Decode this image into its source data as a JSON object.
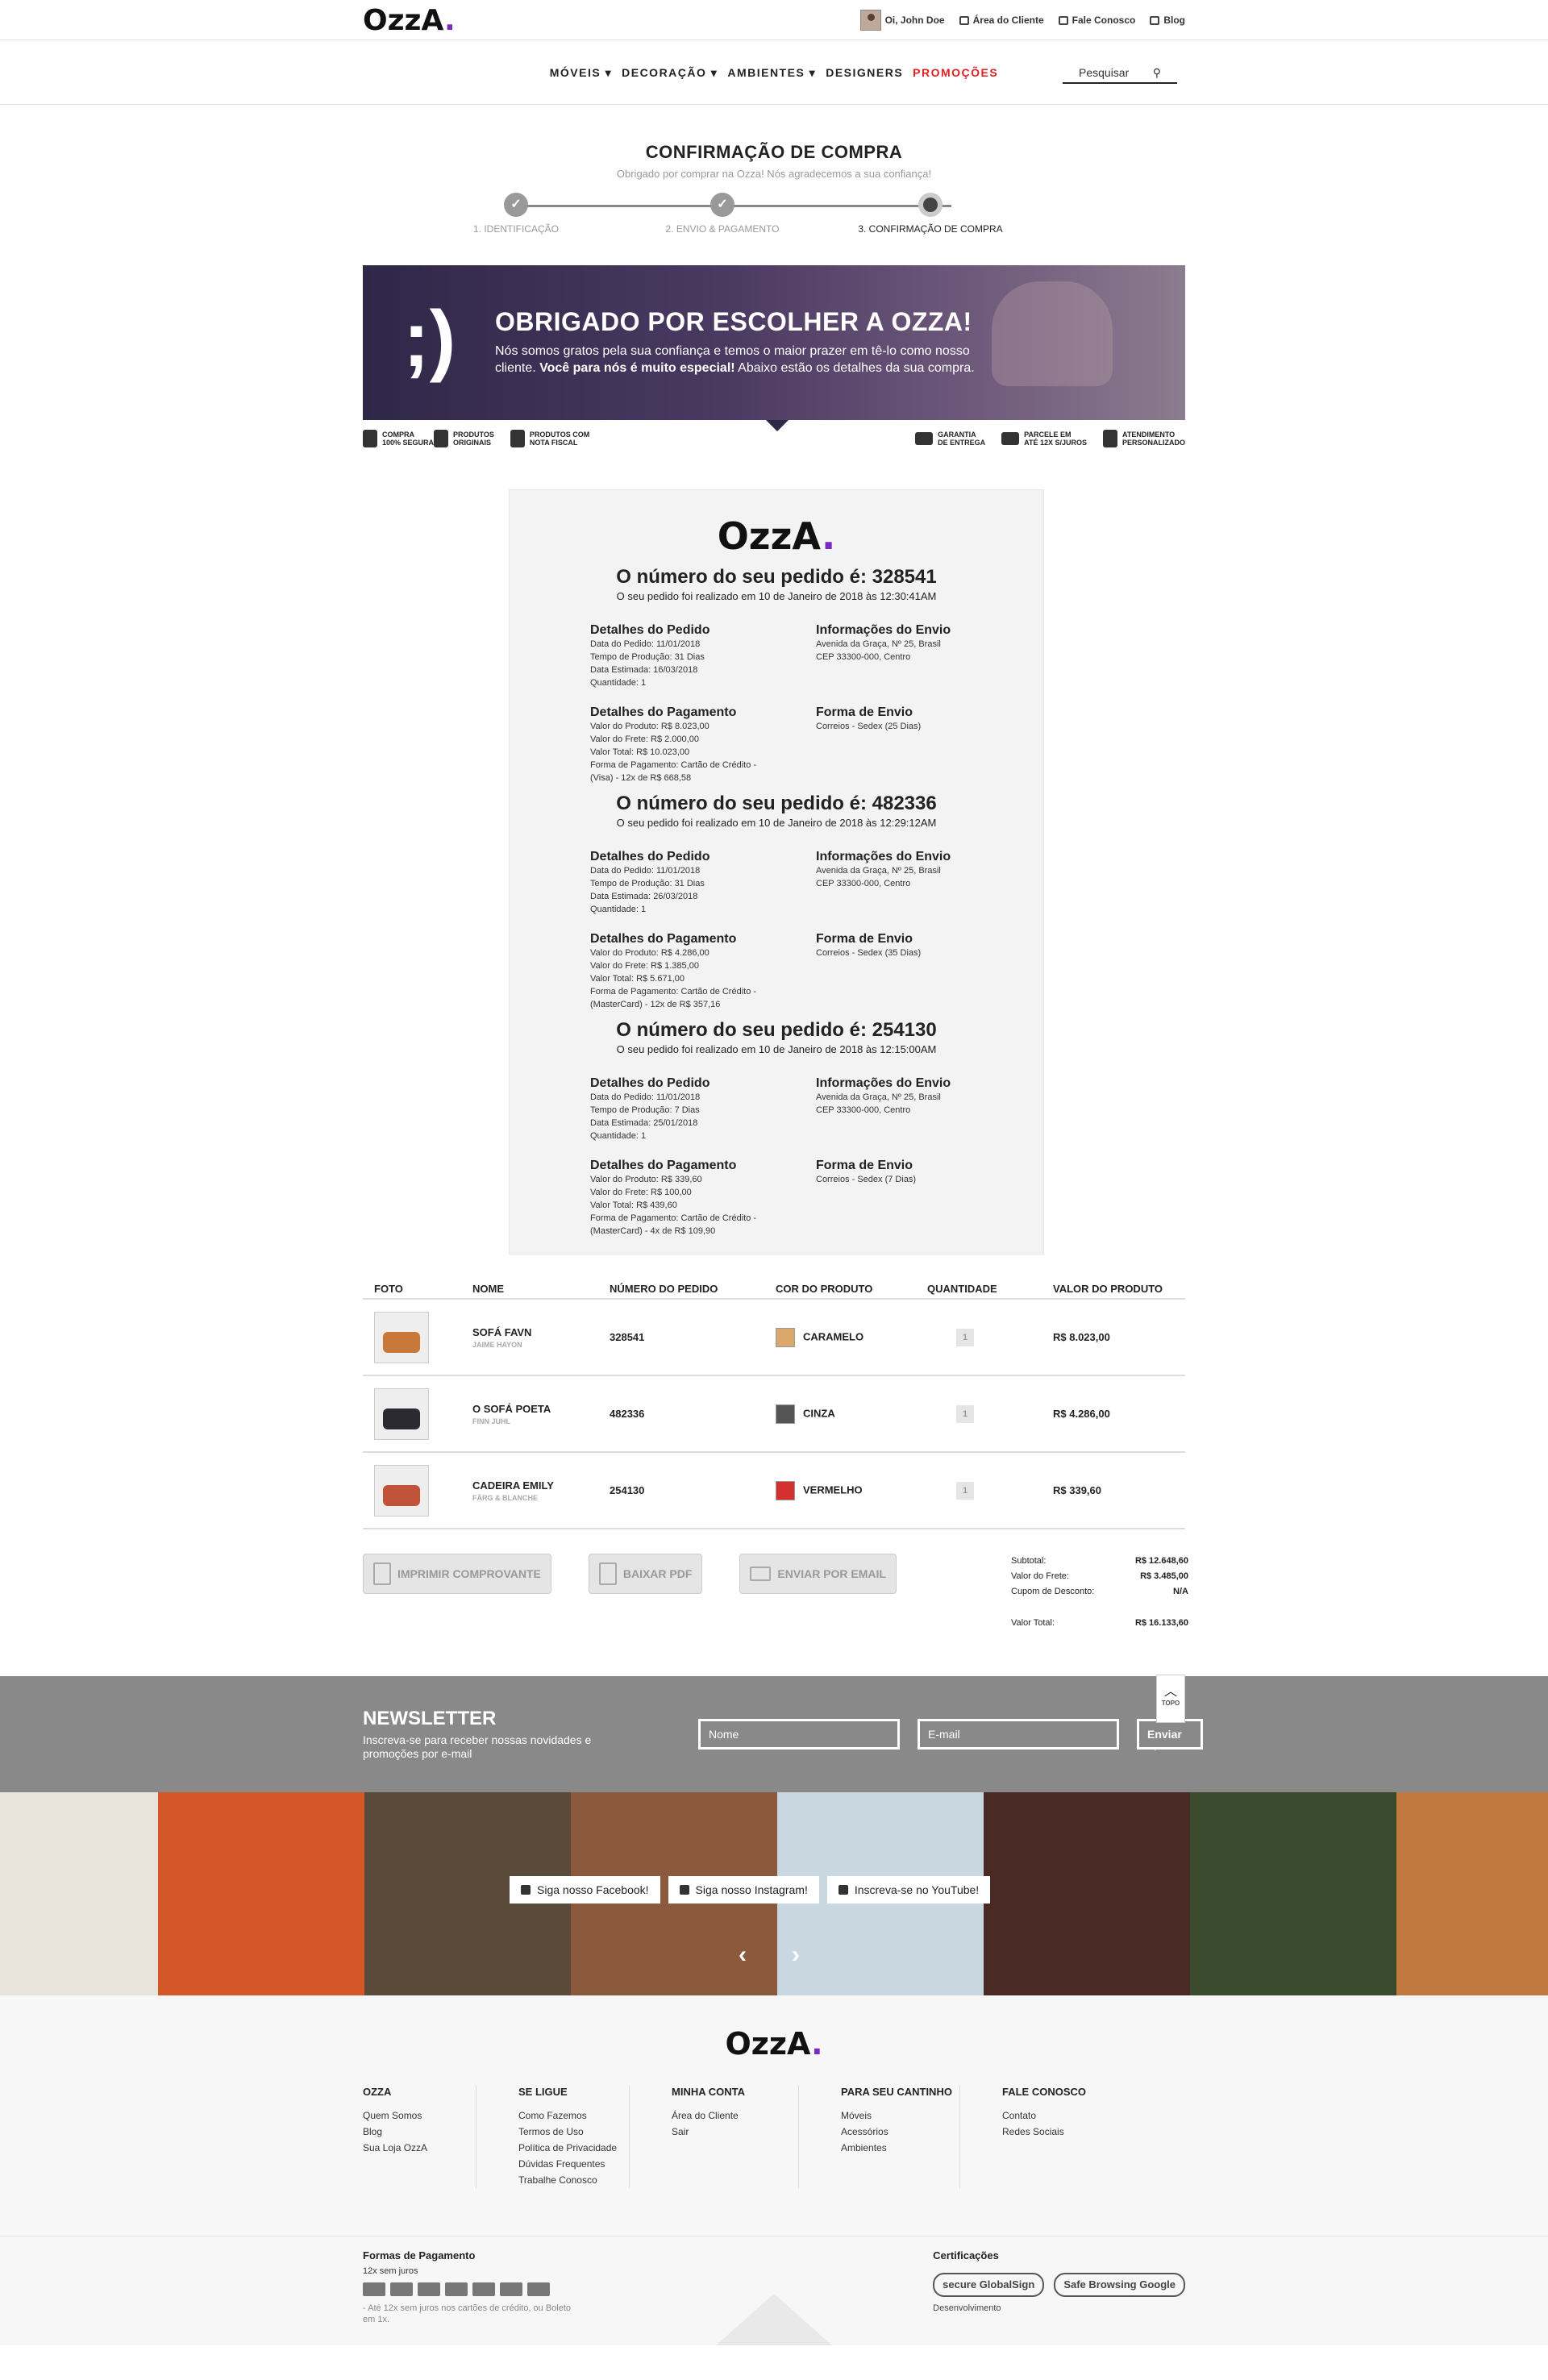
{
  "brand": {
    "logo_text": "OzzA",
    "logo_dot": "."
  },
  "topbar": {
    "greeting": "Oi, John Doe",
    "client_area": "Área do Cliente",
    "contact": "Fale Conosco",
    "blog": "Blog"
  },
  "nav": {
    "items": [
      {
        "label": "MÓVEIS",
        "caret": "▾"
      },
      {
        "label": "DECORAÇÃO",
        "caret": "▾"
      },
      {
        "label": "AMBIENTES",
        "caret": "▾"
      },
      {
        "label": "DESIGNERS",
        "caret": ""
      }
    ],
    "promo": "PROMOÇÕES",
    "search_placeholder": "Pesquisar"
  },
  "checkout": {
    "title": "CONFIRMAÇÃO DE COMPRA",
    "subtitle": "Obrigado por comprar na Ozza! Nós agradecemos a sua confiança!",
    "steps": [
      "1. IDENTIFICAÇÃO",
      "2. ENVIO & PAGAMENTO",
      "3. CONFIRMAÇÃO DE COMPRA"
    ]
  },
  "banner": {
    "wink": ";)",
    "title": "OBRIGADO POR ESCOLHER A OZZA!",
    "line1": "Nós somos gratos pela sua confiança e temos o maior prazer em tê-lo como nosso",
    "line2a": "cliente. ",
    "line2b": "Você para nós é muito especial!",
    "line2c": "  Abaixo estão os detalhes da sua compra."
  },
  "trust": [
    [
      "COMPRA",
      "100% SEGURA"
    ],
    [
      "PRODUTOS",
      "ORIGINAIS"
    ],
    [
      "PRODUTOS COM",
      "NOTA FISCAL"
    ],
    [
      "GARANTIA",
      "DE ENTREGA"
    ],
    [
      "PARCELE EM",
      "ATÉ 12X S/JUROS"
    ],
    [
      "ATENDIMENTO",
      "PERSONALIZADO"
    ]
  ],
  "orders": [
    {
      "heading": "O número do seu pedido é: 328541",
      "placed": "O seu pedido foi realizado em 10 de Janeiro de 2018 às 12:30:41AM",
      "details_title": "Detalhes do Pedido",
      "details": [
        "Data do Pedido: 11/01/2018",
        "Tempo de Produção: 31 Dias",
        "Data Estimada: 16/03/2018",
        "Quantidade: 1"
      ],
      "ship_title": "Informações do Envio",
      "ship": [
        "Avenida da Graça, Nº 25, Brasil",
        "CEP 33300-000, Centro"
      ],
      "pay_title": "Detalhes do Pagamento",
      "pay": [
        "Valor do Produto: R$ 8.023,00",
        "Valor do Frete: R$ 2.000,00",
        "Valor Total: R$ 10.023,00",
        "Forma de Pagamento: Cartão de Crédito -",
        "(Visa) - 12x de R$ 668,58"
      ],
      "method_title": "Forma de Envio",
      "method": "Correios - Sedex (25 Dias)"
    },
    {
      "heading": "O número do seu pedido é: 482336",
      "placed": "O seu pedido foi realizado em 10 de Janeiro de 2018 às 12:29:12AM",
      "details_title": "Detalhes do Pedido",
      "details": [
        "Data do Pedido: 11/01/2018",
        "Tempo de Produção: 31 Dias",
        "Data Estimada: 26/03/2018",
        "Quantidade: 1"
      ],
      "ship_title": "Informações do Envio",
      "ship": [
        "Avenida da Graça, Nº 25, Brasil",
        "CEP 33300-000, Centro"
      ],
      "pay_title": "Detalhes do Pagamento",
      "pay": [
        "Valor do Produto: R$ 4.286,00",
        "Valor do Frete: R$ 1.385,00",
        "Valor Total: R$ 5.671,00",
        "Forma de Pagamento: Cartão de Crédito -",
        "(MasterCard) - 12x de R$ 357,16"
      ],
      "method_title": "Forma de Envio",
      "method": "Correios - Sedex (35 Dias)"
    },
    {
      "heading": "O número do seu pedido é: 254130",
      "placed": "O seu pedido foi realizado em 10 de Janeiro de 2018 às 12:15:00AM",
      "details_title": "Detalhes do Pedido",
      "details": [
        "Data do Pedido: 11/01/2018",
        "Tempo de Produção: 7 Dias",
        "Data Estimada: 25/01/2018",
        "Quantidade: 1"
      ],
      "ship_title": "Informações do Envio",
      "ship": [
        "Avenida da Graça, Nº 25, Brasil",
        "CEP 33300-000, Centro"
      ],
      "pay_title": "Detalhes do Pagamento",
      "pay": [
        "Valor do Produto: R$ 339,60",
        "Valor do Frete: R$ 100,00",
        "Valor Total: R$ 439,60",
        "Forma de Pagamento: Cartão de Crédito -",
        "(MasterCard) - 4x de R$ 109,90"
      ],
      "method_title": "Forma de Envio",
      "method": "Correios - Sedex (7 Dias)"
    }
  ],
  "table": {
    "headers": [
      "FOTO",
      "NOME",
      "NÚMERO DO PEDIDO",
      "COR DO PRODUTO",
      "QUANTIDADE",
      "VALOR DO PRODUTO"
    ],
    "rows": [
      {
        "name": "SOFÁ FAVN",
        "designer": "JAIME HAYON",
        "order": "328541",
        "color_name": "CARAMELO",
        "color": "#d9a86a",
        "qty": "1",
        "value": "R$ 8.023,00",
        "thumb": "#c8793a"
      },
      {
        "name": "O SOFÁ POETA",
        "designer": "FINN JUHL",
        "order": "482336",
        "color_name": "CINZA",
        "color": "#555555",
        "qty": "1",
        "value": "R$ 4.286,00",
        "thumb": "#2a2a30"
      },
      {
        "name": "CADEIRA EMILY",
        "designer": "FÄRG & BLANCHE",
        "order": "254130",
        "color_name": "VERMELHO",
        "color": "#d32f2f",
        "qty": "1",
        "value": "R$ 339,60",
        "thumb": "#c0533a"
      }
    ]
  },
  "actions": {
    "print": "IMPRIMIR COMPROVANTE",
    "pdf": "BAIXAR PDF",
    "email": "ENVIAR POR EMAIL"
  },
  "totals": {
    "subtotal_label": "Subtotal:",
    "subtotal": "R$ 12.648,60",
    "freight_label": "Valor do Frete:",
    "freight": "R$ 3.485,00",
    "coupon_label": "Cupom de Desconto:",
    "coupon": "N/A",
    "total_label": "Valor Total:",
    "total": "R$ 16.133,60"
  },
  "topo": {
    "arrow": "︿",
    "label": "TOPO"
  },
  "newsletter": {
    "title": "NEWSLETTER",
    "text": "Inscreva-se para receber nossas novidades e promoções por e-mail",
    "name_placeholder": "Nome",
    "email_placeholder": "E-mail",
    "submit": "Enviar →"
  },
  "social": {
    "facebook": "Siga nosso Facebook!",
    "instagram": "Siga nosso Instagram!",
    "youtube": "Inscreva-se no YouTube!"
  },
  "gallery": {
    "colors": [
      "#e8e4dc",
      "#d4572a",
      "#5a4a3a",
      "#8b5a3c",
      "#c9d8e0",
      "#4a2a24",
      "#3a4a2c",
      "#c07a40"
    ]
  },
  "footer": {
    "cols": [
      {
        "title": "OZZA",
        "links": [
          "Quem Somos",
          "Blog",
          "Sua Loja OzzA"
        ]
      },
      {
        "title": "SE LIGUE",
        "links": [
          "Como Fazemos",
          "Termos de Uso",
          "Política de Privacidade",
          "Dúvidas Frequentes",
          "Trabalhe Conosco"
        ]
      },
      {
        "title": "MINHA CONTA",
        "links": [
          "Área do Cliente",
          "Sair"
        ]
      },
      {
        "title": "PARA SEU CANTINHO",
        "links": [
          "Móveis",
          "Acessórios",
          "Ambientes"
        ]
      },
      {
        "title": "FALE CONOSCO",
        "links": [
          "Contato",
          "Redes Sociais"
        ]
      }
    ],
    "payments_title": "Formas de Pagamento",
    "payments_sub": "12x sem juros",
    "payments_note": "- Até 12x sem juros nos cartões de crédito, ou Boleto em 1x.",
    "certs_title": "Certificações",
    "cert1": "secure GlobalSign",
    "cert2": "Safe Browsing Google",
    "dev": "Desenvolvimento"
  }
}
